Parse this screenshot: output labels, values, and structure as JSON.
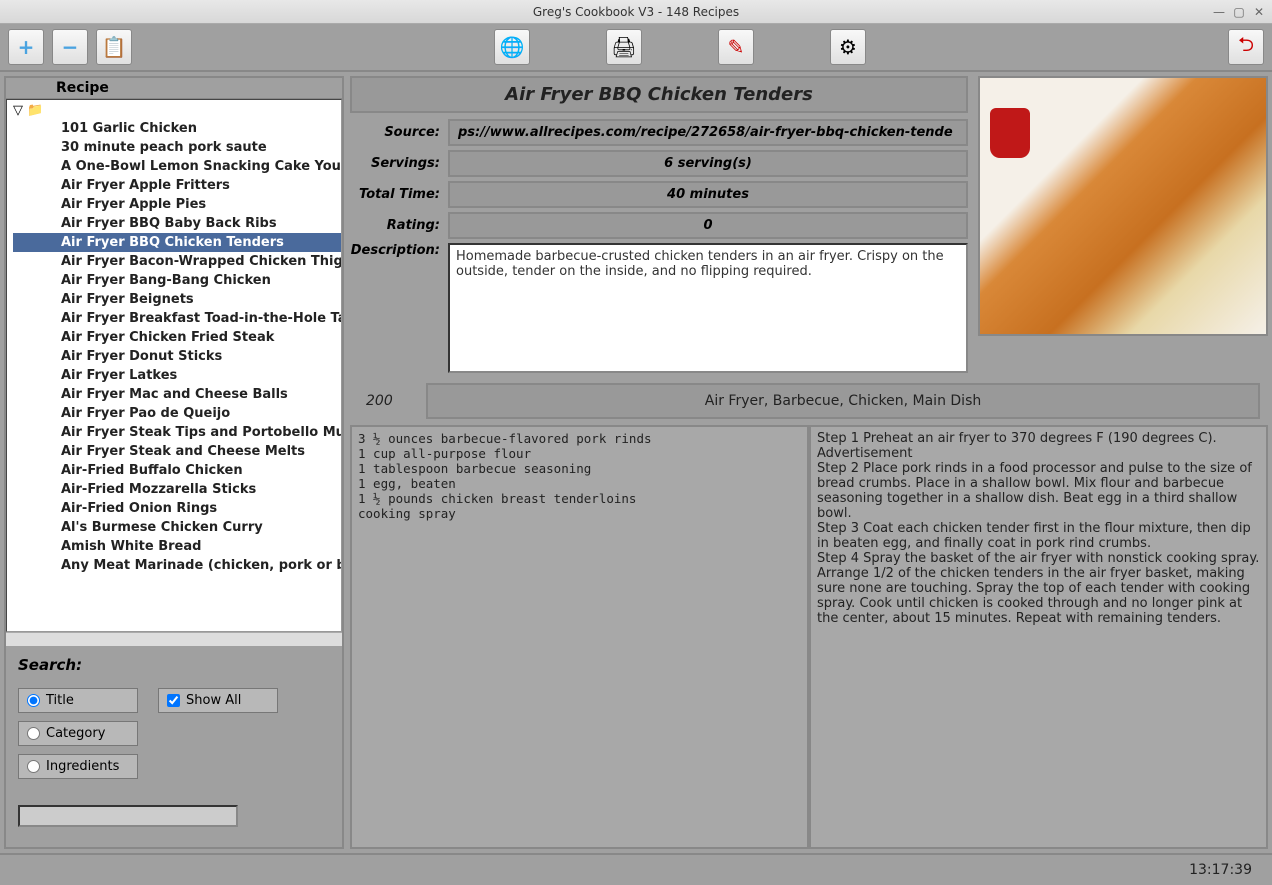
{
  "window": {
    "title": "Greg's Cookbook V3 - 148 Recipes"
  },
  "toolbar": {
    "add": "+",
    "remove": "−",
    "paste": "📋",
    "web": "🌐",
    "print": "🖨",
    "edit": "✎",
    "settings": "⚙",
    "exit": "⎋"
  },
  "tree": {
    "header": "Recipe",
    "items": [
      "101 Garlic Chicken",
      "30 minute peach pork saute",
      "A One-Bowl Lemon Snacking Cake You'll Make Y",
      "Air Fryer Apple Fritters",
      "Air Fryer Apple Pies",
      "Air Fryer BBQ Baby Back Ribs",
      "Air Fryer BBQ Chicken Tenders",
      "Air Fryer Bacon-Wrapped Chicken Thighs",
      "Air Fryer Bang-Bang Chicken",
      "Air Fryer Beignets",
      "Air Fryer Breakfast Toad-in-the-Hole Tarts",
      "Air Fryer Chicken Fried Steak",
      "Air Fryer Donut Sticks",
      "Air Fryer Latkes",
      "Air Fryer Mac and Cheese Balls",
      "Air Fryer Pao de Queijo",
      "Air Fryer Steak Tips and Portobello Mushrooms",
      "Air Fryer Steak and Cheese Melts",
      "Air-Fried Buffalo Chicken",
      "Air-Fried Mozzarella Sticks",
      "Air-Fried Onion Rings",
      "Al's Burmese Chicken Curry",
      "Amish White Bread",
      "Any Meat Marinade (chicken, pork or beef)"
    ],
    "selectedIndex": 6
  },
  "search": {
    "label": "Search:",
    "title": "Title",
    "category": "Category",
    "ingredients": "Ingredients",
    "showAll": "Show All"
  },
  "recipe": {
    "title": "Air Fryer BBQ Chicken Tenders",
    "labels": {
      "source": "Source:",
      "servings": "Servings:",
      "totalTime": "Total Time:",
      "rating": "Rating:",
      "description": "Description:"
    },
    "source": "ps://www.allrecipes.com/recipe/272658/air-fryer-bbq-chicken-tende",
    "servings": "6 serving(s)",
    "totalTime": "40 minutes",
    "rating": "0",
    "description": "Homemade barbecue-crusted chicken tenders in an air fryer. Crispy on the outside, tender on the inside, and no flipping required.",
    "count": "200",
    "tags": "Air Fryer, Barbecue, Chicken, Main Dish",
    "ingredients": "3 ½ ounces barbecue-flavored pork rinds\n1 cup all-purpose flour\n1 tablespoon barbecue seasoning\n1 egg, beaten\n1 ½ pounds chicken breast tenderloins\ncooking spray",
    "instructions": "Step 1 Preheat an air fryer to 370 degrees F (190 degrees C). Advertisement\nStep 2 Place pork rinds in a food processor and pulse to the size of bread crumbs. Place in a shallow bowl. Mix flour and barbecue seasoning together in a shallow dish. Beat egg in a third shallow bowl.\nStep 3 Coat each chicken tender first in the flour mixture, then dip in beaten egg, and finally coat in pork rind crumbs.\nStep 4 Spray the basket of the air fryer with nonstick cooking spray. Arrange 1/2 of the chicken tenders in the air fryer basket, making sure none are touching. Spray the top of each tender with cooking spray. Cook until chicken is cooked through and no longer pink at the center, about 15 minutes. Repeat with remaining tenders."
  },
  "status": {
    "time": "13:17:39"
  }
}
